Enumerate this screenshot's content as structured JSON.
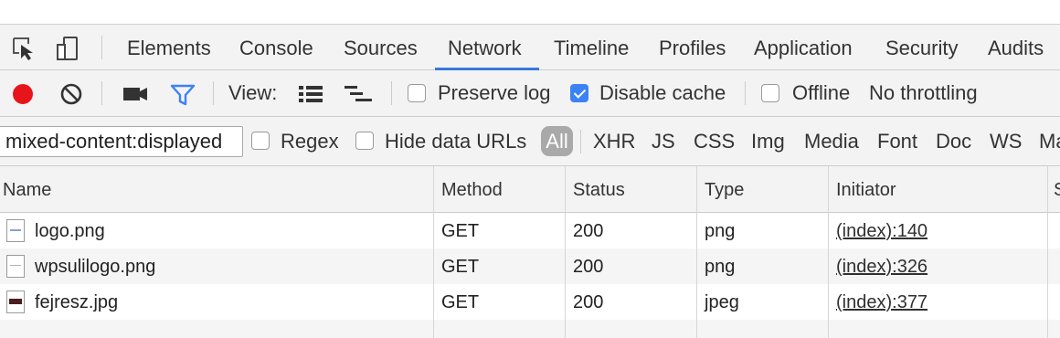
{
  "tabs": [
    {
      "label": "Elements"
    },
    {
      "label": "Console"
    },
    {
      "label": "Sources"
    },
    {
      "label": "Network",
      "active": true
    },
    {
      "label": "Timeline"
    },
    {
      "label": "Profiles"
    },
    {
      "label": "Application"
    },
    {
      "label": "Security"
    },
    {
      "label": "Audits"
    }
  ],
  "toolbar": {
    "view_label": "View:",
    "preserve_log_label": "Preserve log",
    "preserve_log_checked": false,
    "disable_cache_label": "Disable cache",
    "disable_cache_checked": true,
    "offline_label": "Offline",
    "offline_checked": false,
    "throttling_label": "No throttling",
    "record_color": "#e8141b",
    "filter_color": "#3b82f6"
  },
  "filter": {
    "value": "mixed-content:displayed",
    "regex_label": "Regex",
    "hide_data_urls_label": "Hide data URLs",
    "all_label": "All",
    "types": [
      "XHR",
      "JS",
      "CSS",
      "Img",
      "Media",
      "Font",
      "Doc",
      "WS",
      "Ma"
    ]
  },
  "table": {
    "columns": [
      "Name",
      "Method",
      "Status",
      "Type",
      "Initiator",
      "S"
    ],
    "rows": [
      {
        "name": "logo.png",
        "method": "GET",
        "status": "200",
        "type": "png",
        "initiator": "(index):140"
      },
      {
        "name": "wpsulilogo.png",
        "method": "GET",
        "status": "200",
        "type": "png",
        "initiator": "(index):326"
      },
      {
        "name": "fejresz.jpg",
        "method": "GET",
        "status": "200",
        "type": "jpeg",
        "initiator": "(index):377"
      }
    ]
  }
}
